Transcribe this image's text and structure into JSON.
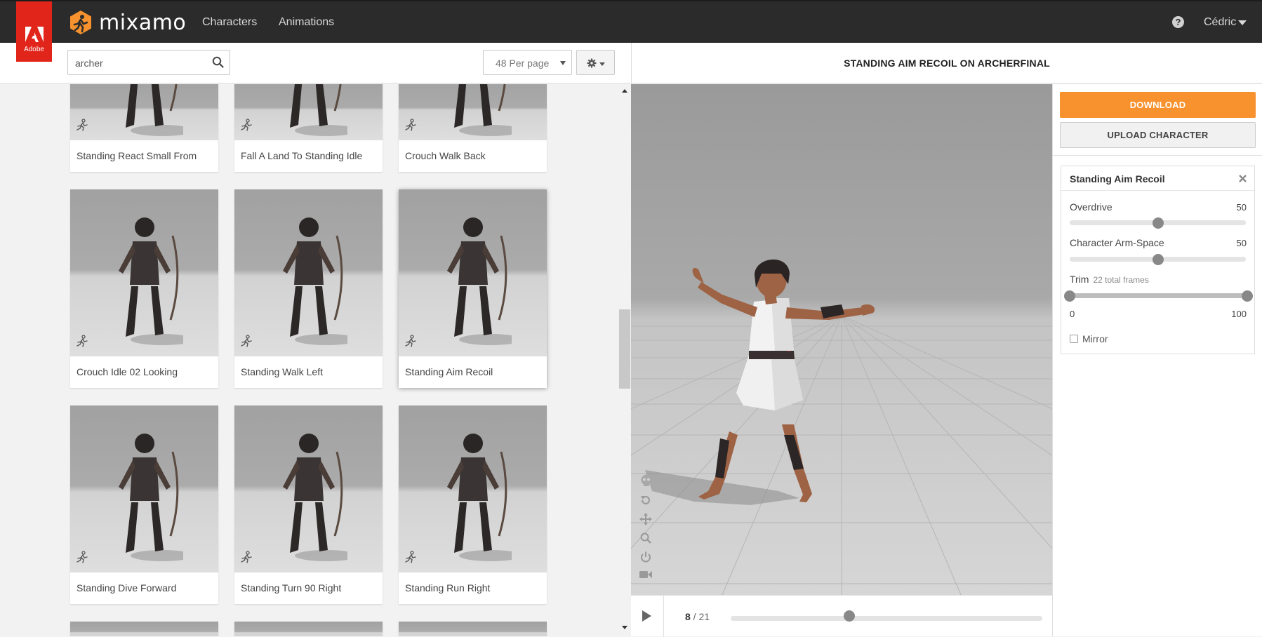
{
  "header": {
    "adobe_label": "Adobe",
    "brand": "mixamo",
    "nav": [
      "Characters",
      "Animations"
    ],
    "help": "?",
    "user": "Cédric"
  },
  "toolbar": {
    "search_value": "archer",
    "per_page": "48 Per page"
  },
  "grid": {
    "cards": [
      {
        "label": "Standing React Small From",
        "selected": false
      },
      {
        "label": "Fall A Land To Standing Idle",
        "selected": false
      },
      {
        "label": "Crouch Walk Back",
        "selected": false
      },
      {
        "label": "Crouch Idle 02 Looking",
        "selected": false
      },
      {
        "label": "Standing Walk Left",
        "selected": false
      },
      {
        "label": "Standing Aim Recoil",
        "selected": true
      },
      {
        "label": "Standing Dive Forward",
        "selected": false
      },
      {
        "label": "Standing Turn 90 Right",
        "selected": false
      },
      {
        "label": "Standing Run Right",
        "selected": false
      }
    ]
  },
  "viewer": {
    "title": "STANDING AIM RECOIL ON ARCHERFINAL",
    "frame_current": "8",
    "frame_sep": " / ",
    "frame_total": "21",
    "timeline_progress": 0.38
  },
  "panel": {
    "download": "DOWNLOAD",
    "upload": "UPLOAD CHARACTER",
    "anim_title": "Standing Aim Recoil",
    "overdrive_label": "Overdrive",
    "overdrive_value": "50",
    "overdrive_fraction": 0.5,
    "armspace_label": "Character Arm-Space",
    "armspace_value": "50",
    "armspace_fraction": 0.5,
    "trim_label": "Trim",
    "trim_sub": "22 total frames",
    "trim_min": "0",
    "trim_max": "100",
    "mirror_label": "Mirror"
  },
  "colors": {
    "adobe_red": "#e1251b",
    "download_orange": "#f7922e",
    "topbar": "#2b2b2b"
  }
}
